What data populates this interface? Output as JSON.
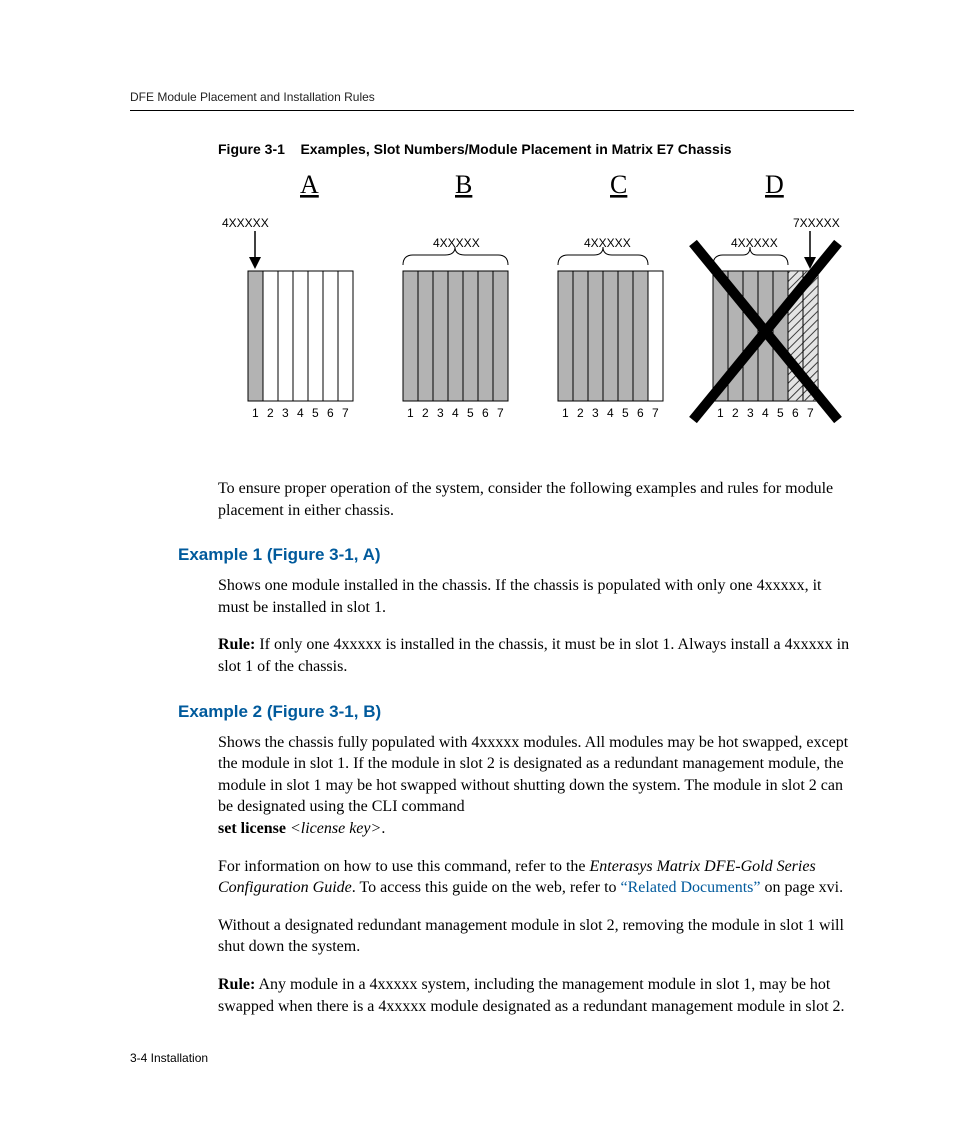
{
  "header": "DFE Module Placement and Installation Rules",
  "figure": {
    "label": "Figure 3-1",
    "title": "Examples, Slot Numbers/Module Placement in Matrix E7 Chassis",
    "panels": [
      "A",
      "B",
      "C",
      "D"
    ],
    "labels": {
      "four": "4XXXXX",
      "seven": "7XXXXX"
    },
    "slots": [
      "1",
      "2",
      "3",
      "4",
      "5",
      "6",
      "7"
    ]
  },
  "intro": "To ensure proper operation of the system, consider the following examples and rules for module placement in either chassis.",
  "example1": {
    "heading_pre": "Example 1 (",
    "heading_link": "Figure 3-1",
    "heading_post": ", A)",
    "p1": "Shows one module installed in the chassis. If the chassis is populated with only one 4xxxxx, it must be installed in slot 1.",
    "rule_label": "Rule:",
    "rule": " If only one 4xxxxx is installed in the chassis, it must be in slot 1. Always install a 4xxxxx in slot 1 of the chassis."
  },
  "example2": {
    "heading_pre": "Example 2 (",
    "heading_link": "Figure 3-1",
    "heading_post": ", B)",
    "p1_a": "Shows the chassis fully populated with 4xxxxx modules. All modules may be hot swapped, except the module in slot 1. If the module in slot 2 is designated as a redundant management module, the module in slot 1 may be hot swapped without shutting down the system. The module in slot 2 can be designated using the CLI command ",
    "p1_cmd": "set license",
    "p1_arg": " <license key>",
    "p1_end": ".",
    "p2_a": "For information on how to use this command, refer to the ",
    "p2_i": "Enterasys Matrix DFE-Gold Series Configuration Guide",
    "p2_b": ". To access this guide on the web, refer to  ",
    "p2_link": "“Related Documents”",
    "p2_c": " on page xvi.",
    "p3": "Without a designated redundant management module in slot 2, removing the module in slot 1 will shut down the system.",
    "rule_label": "Rule:",
    "rule": " Any module in a 4xxxxx system, including the management module in slot 1, may be hot swapped when there is a 4xxxxx module designated as a redundant management module in slot 2."
  },
  "footer": "3-4   Installation"
}
